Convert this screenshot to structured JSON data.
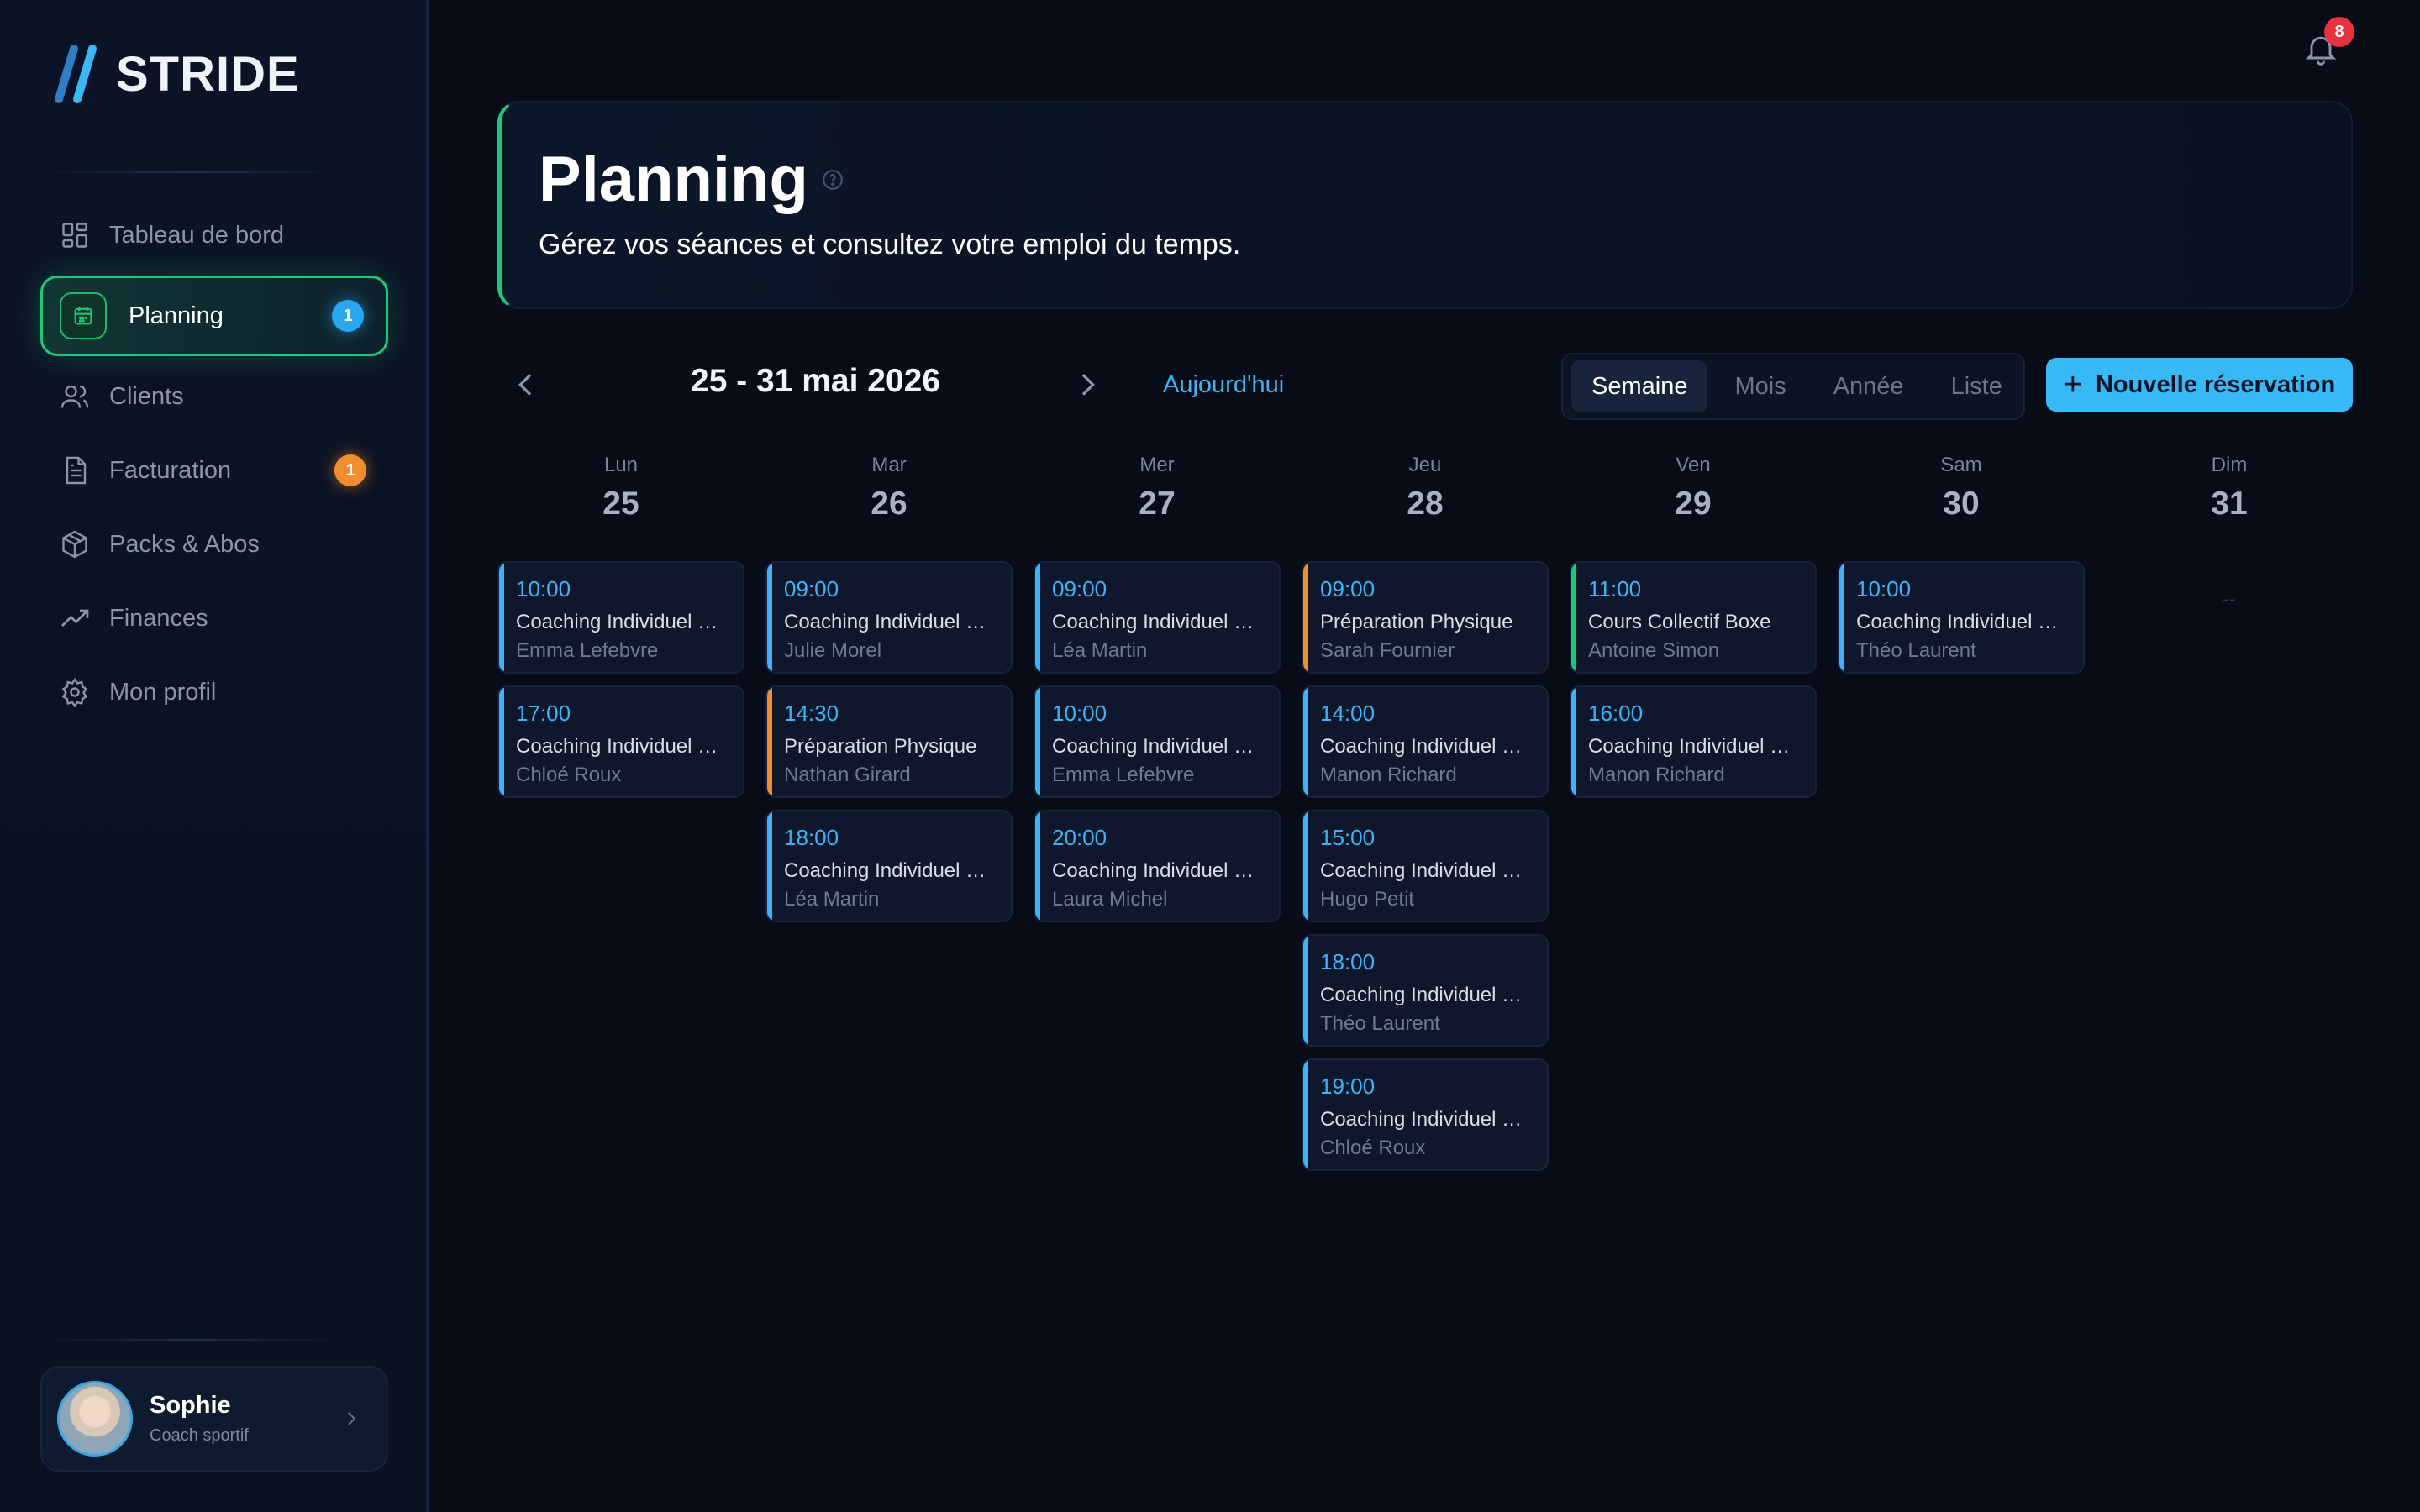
{
  "app": {
    "name": "STRIDE"
  },
  "nav": [
    {
      "label": "Tableau de bord",
      "icon": "dashboard-icon"
    },
    {
      "label": "Planning",
      "icon": "calendar-icon",
      "badge": "1",
      "active": true
    },
    {
      "label": "Clients",
      "icon": "users-icon"
    },
    {
      "label": "Facturation",
      "icon": "invoice-icon",
      "badge": "1"
    },
    {
      "label": "Packs & Abos",
      "icon": "package-icon"
    },
    {
      "label": "Finances",
      "icon": "trending-up-icon"
    },
    {
      "label": "Mon profil",
      "icon": "gear-icon"
    }
  ],
  "user": {
    "name": "Sophie",
    "role": "Coach sportif"
  },
  "notifications": {
    "count": "8"
  },
  "header": {
    "title": "Planning",
    "subtitle": "Gérez vos séances et consultez votre emploi du temps."
  },
  "toolbar": {
    "range": "25 - 31 mai 2026",
    "today": "Aujourd'hui",
    "views": [
      "Semaine",
      "Mois",
      "Année",
      "Liste"
    ],
    "active_view": "Semaine",
    "new_button": "Nouvelle réservation"
  },
  "colors": {
    "blue": "#3db4f5",
    "orange": "#f08d2c",
    "green": "#1fc77a"
  },
  "days": [
    {
      "name": "Lun",
      "num": "25",
      "events": [
        {
          "time": "10:00",
          "title": "Coaching Individuel B...",
          "client": "Emma Lefebvre",
          "color": "blue"
        },
        {
          "time": "17:00",
          "title": "Coaching Individuel B...",
          "client": "Chloé Roux",
          "color": "blue"
        }
      ]
    },
    {
      "name": "Mar",
      "num": "26",
      "events": [
        {
          "time": "09:00",
          "title": "Coaching Individuel B...",
          "client": "Julie Morel",
          "color": "blue"
        },
        {
          "time": "14:30",
          "title": "Préparation Physique",
          "client": "Nathan Girard",
          "color": "orange"
        },
        {
          "time": "18:00",
          "title": "Coaching Individuel B...",
          "client": "Léa Martin",
          "color": "blue"
        }
      ]
    },
    {
      "name": "Mer",
      "num": "27",
      "events": [
        {
          "time": "09:00",
          "title": "Coaching Individuel B...",
          "client": "Léa Martin",
          "color": "blue"
        },
        {
          "time": "10:00",
          "title": "Coaching Individuel B...",
          "client": "Emma Lefebvre",
          "color": "blue"
        },
        {
          "time": "20:00",
          "title": "Coaching Individuel B...",
          "client": "Laura Michel",
          "color": "blue"
        }
      ]
    },
    {
      "name": "Jeu",
      "num": "28",
      "events": [
        {
          "time": "09:00",
          "title": "Préparation Physique",
          "client": "Sarah Fournier",
          "color": "orange"
        },
        {
          "time": "14:00",
          "title": "Coaching Individuel B...",
          "client": "Manon Richard",
          "color": "blue"
        },
        {
          "time": "15:00",
          "title": "Coaching Individuel B...",
          "client": "Hugo Petit",
          "color": "blue"
        },
        {
          "time": "18:00",
          "title": "Coaching Individuel B...",
          "client": "Théo Laurent",
          "color": "blue"
        },
        {
          "time": "19:00",
          "title": "Coaching Individuel B...",
          "client": "Chloé Roux",
          "color": "blue"
        }
      ]
    },
    {
      "name": "Ven",
      "num": "29",
      "events": [
        {
          "time": "11:00",
          "title": "Cours Collectif Boxe",
          "client": "Antoine Simon",
          "color": "green"
        },
        {
          "time": "16:00",
          "title": "Coaching Individuel B...",
          "client": "Manon Richard",
          "color": "blue"
        }
      ]
    },
    {
      "name": "Sam",
      "num": "30",
      "events": [
        {
          "time": "10:00",
          "title": "Coaching Individuel B...",
          "client": "Théo Laurent",
          "color": "blue"
        }
      ]
    },
    {
      "name": "Dim",
      "num": "31",
      "events": [],
      "empty": "--"
    }
  ]
}
